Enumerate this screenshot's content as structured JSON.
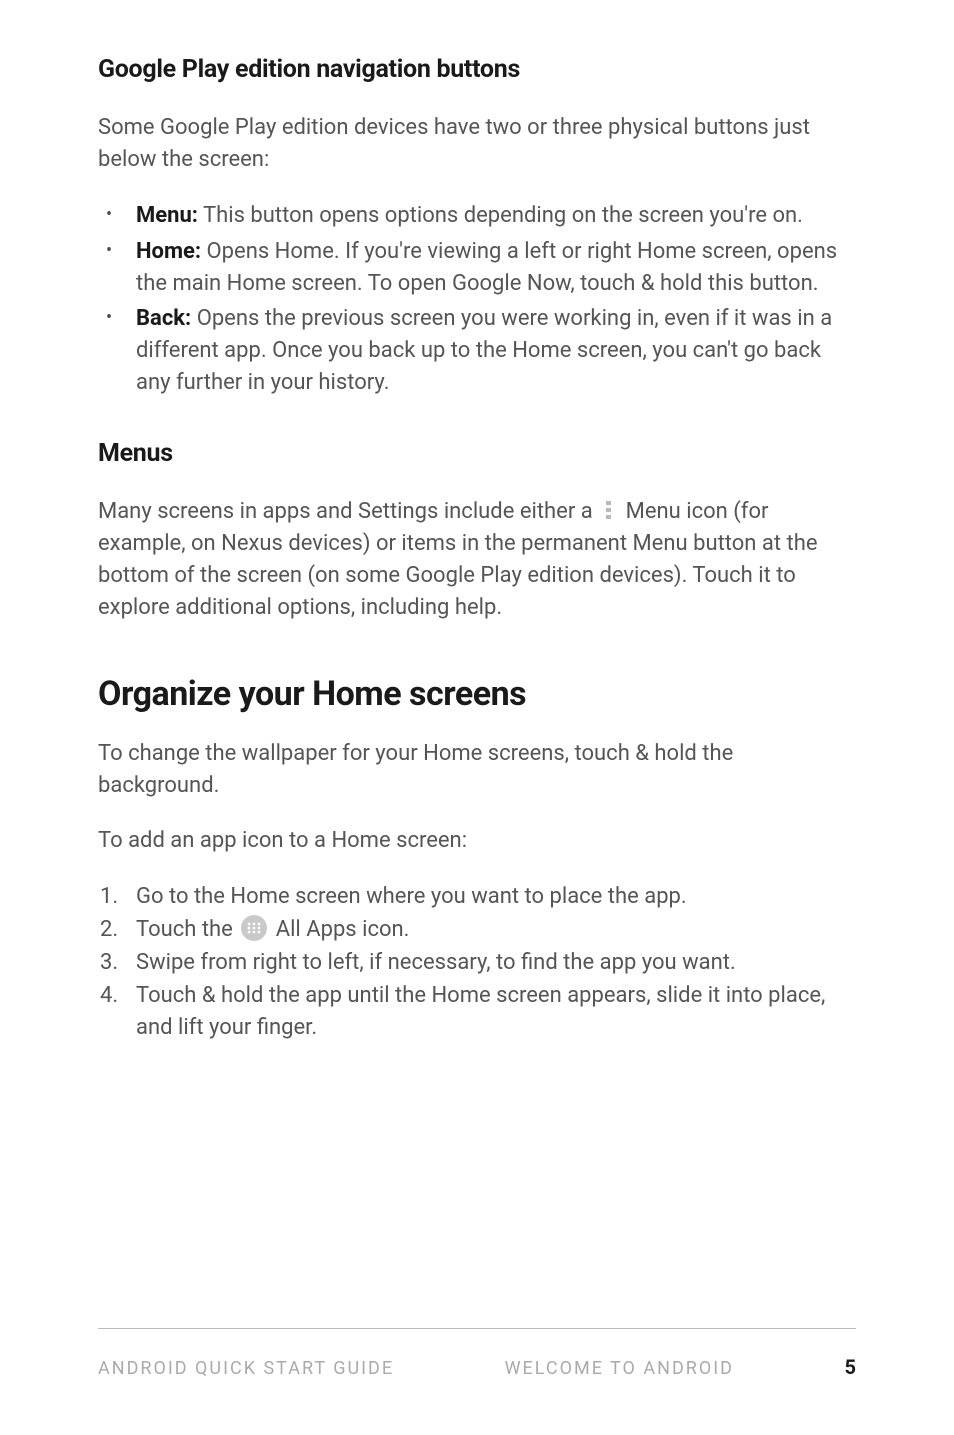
{
  "section1": {
    "heading": "Google Play edition navigation buttons",
    "intro": "Some Google Play edition devices have two or three physical buttons just below the screen:",
    "items": [
      {
        "label": "Menu:",
        "text": " This button opens options depending on the screen you're on."
      },
      {
        "label": "Home:",
        "text": " Opens Home. If you're viewing a left or right Home screen, opens the main Home screen. To open Google Now, touch & hold this button."
      },
      {
        "label": "Back:",
        "text": " Opens the previous screen you were working in, even if it was in a different app. Once you back up to the Home screen, you can't go back any further in your history."
      }
    ]
  },
  "section2": {
    "heading": "Menus",
    "para_before_icon": "Many screens in apps and Settings include either a ",
    "para_after_icon": " Menu icon (for example, on Nexus devices) or items in the permanent Menu button at the bottom of the screen (on some Google Play edition devices). Touch it to explore additional options, including help."
  },
  "section3": {
    "heading": "Organize your Home screens",
    "para1": "To change the wallpaper for your Home screens, touch & hold the background.",
    "para2": "To add an app icon to a Home screen:",
    "steps": {
      "s1": "Go to the Home screen where you want to place the app.",
      "s2_before": "Touch the ",
      "s2_after": " All Apps icon.",
      "s3": "Swipe from right to left, if necessary, to find the app you want.",
      "s4": "Touch & hold the app until the Home screen appears, slide it into place, and lift your finger."
    }
  },
  "footer": {
    "left": "ANDROID QUICK START GUIDE",
    "center": "WELCOME TO ANDROID",
    "page": "5"
  }
}
